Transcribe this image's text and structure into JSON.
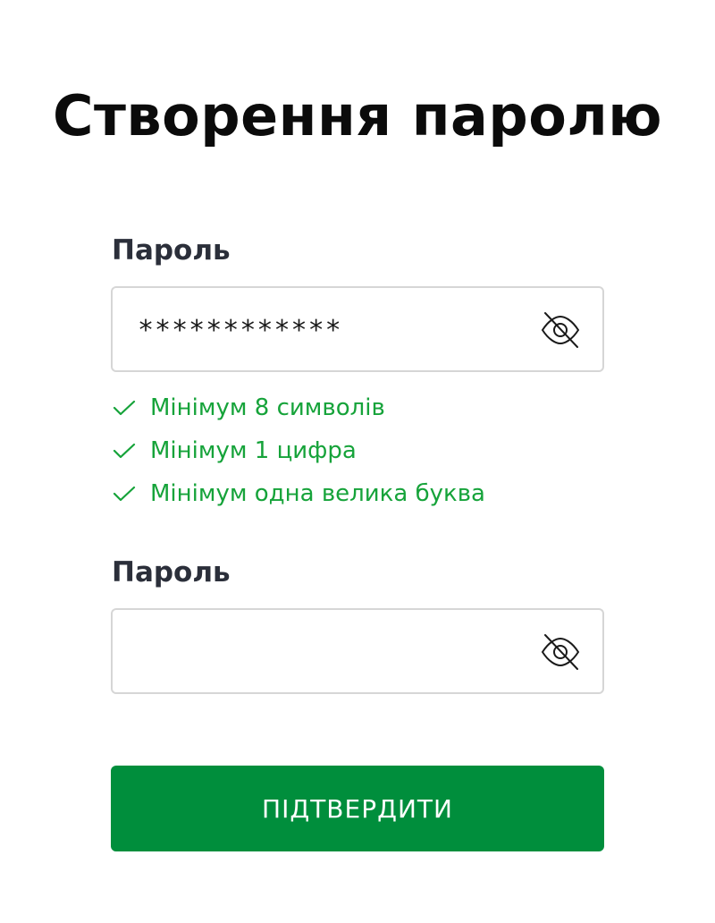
{
  "page": {
    "title": "Створення паролю"
  },
  "password_field": {
    "label": "Пароль",
    "value": "************",
    "toggle_icon": "eye-slash-icon"
  },
  "requirements": [
    {
      "icon": "check-icon",
      "text": "Мінімум 8 символів"
    },
    {
      "icon": "check-icon",
      "text": "Мінімум 1 цифра"
    },
    {
      "icon": "check-icon",
      "text": "Мінімум одна велика буква"
    }
  ],
  "confirm_field": {
    "label": "Пароль",
    "value": "",
    "toggle_icon": "eye-slash-icon"
  },
  "submit": {
    "label": "ПІДТВЕРДИТИ"
  },
  "colors": {
    "accent": "#008e3c",
    "success_text": "#16a33a",
    "label_text": "#2b2f3a",
    "border": "#d6d6d6"
  }
}
